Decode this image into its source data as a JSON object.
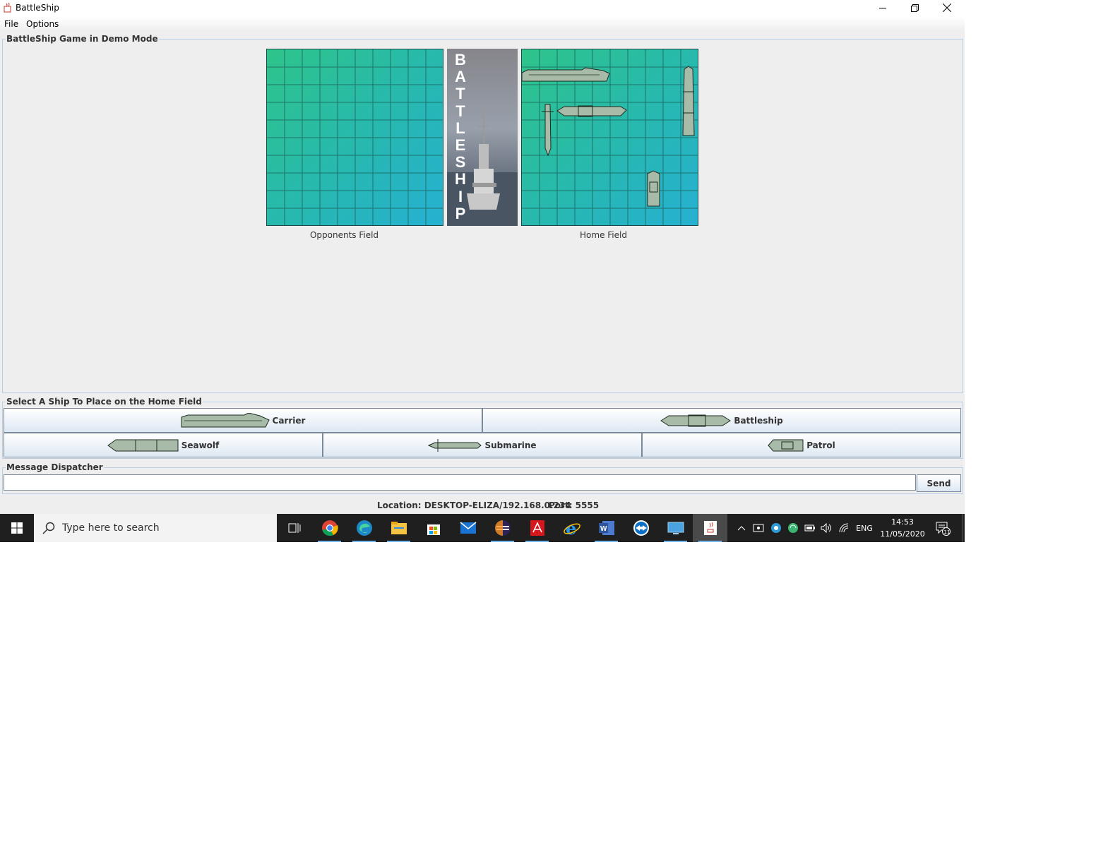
{
  "window": {
    "title": "BattleShip"
  },
  "menu": {
    "file": "File",
    "options": "Options"
  },
  "game_panel": {
    "title": "BattleShip Game in Demo Mode",
    "opponent_label": "Opponents Field",
    "home_label": "Home Field",
    "banner_letters": [
      "B",
      "A",
      "T",
      "T",
      "L",
      "E",
      "S",
      "H",
      "I",
      "P"
    ]
  },
  "ship_panel": {
    "title": "Select A Ship To Place on the Home Field",
    "ships": {
      "carrier": "Carrier",
      "battleship": "Battleship",
      "seawolf": "Seawolf",
      "submarine": "Submarine",
      "patrol": "Patrol"
    }
  },
  "message_panel": {
    "title": "Message Dispatcher",
    "input_value": "",
    "send_label": "Send"
  },
  "status": {
    "location": "Location: DESKTOP-ELIZA/192.168.0.234",
    "port": "Port: 5555"
  },
  "taskbar": {
    "search_placeholder": "Type here to search",
    "language": "ENG",
    "time": "14:53",
    "date": "11/05/2020",
    "notification_count": "11",
    "pinned": [
      "task-view-icon",
      "chrome-icon",
      "edge-icon",
      "file-explorer-icon",
      "store-icon",
      "mail-icon",
      "eclipse-icon",
      "acrobat-icon",
      "internet-explorer-icon",
      "word-icon",
      "teamviewer-icon",
      "desktop-icon",
      "java-icon"
    ]
  },
  "colors": {
    "field_start": "#2ec48a",
    "field_end": "#26b0d2",
    "border": "#b8cfe5",
    "taskbar": "#1f1f1f"
  }
}
